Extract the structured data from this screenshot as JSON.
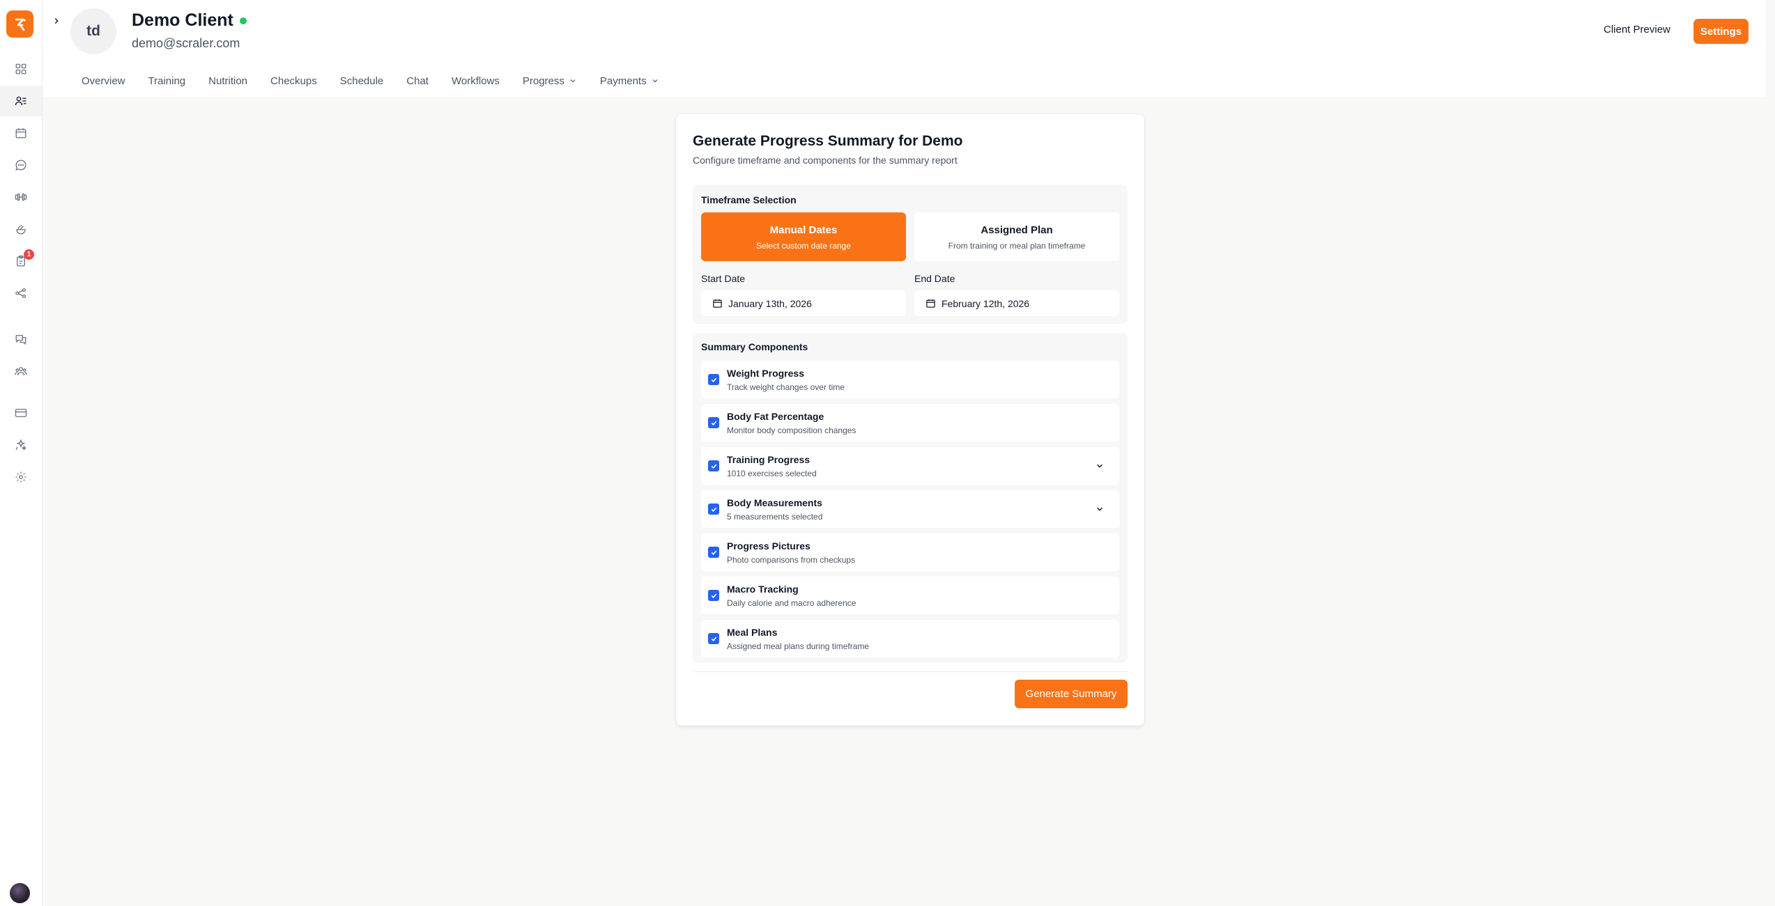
{
  "sidebar": {
    "badge_count": "1",
    "icons": [
      "dashboard-icon",
      "clients-icon",
      "calendar-icon",
      "messages-icon",
      "workouts-icon",
      "nutrition-icon",
      "checkups-icon",
      "workflows-icon",
      "chat-icon",
      "community-icon",
      "payments-icon",
      "ai-icon",
      "settings-icon"
    ],
    "active_item": "clients-icon"
  },
  "header": {
    "avatar_initials": "td",
    "client_name": "Demo Client",
    "client_email": "demo@scraler.com",
    "client_preview_label": "Client Preview",
    "settings_label": "Settings",
    "status": "online"
  },
  "tabs": [
    {
      "label": "Overview"
    },
    {
      "label": "Training"
    },
    {
      "label": "Nutrition"
    },
    {
      "label": "Checkups"
    },
    {
      "label": "Schedule"
    },
    {
      "label": "Chat"
    },
    {
      "label": "Workflows"
    },
    {
      "label": "Progress",
      "has_dropdown": true
    },
    {
      "label": "Payments",
      "has_dropdown": true
    }
  ],
  "summary": {
    "title": "Generate Progress Summary for Demo",
    "subtitle": "Configure timeframe and components for the summary report",
    "timeframe": {
      "section_title": "Timeframe Selection",
      "manual": {
        "title": "Manual Dates",
        "desc": "Select custom date range",
        "selected": true
      },
      "assigned": {
        "title": "Assigned Plan",
        "desc": "From training or meal plan timeframe",
        "selected": false
      },
      "start_label": "Start Date",
      "start_value": "January 13th, 2026",
      "end_label": "End Date",
      "end_value": "February 12th, 2026"
    },
    "components": {
      "section_title": "Summary Components",
      "items": [
        {
          "title": "Weight Progress",
          "desc": "Track weight changes over time",
          "checked": true,
          "expandable": false
        },
        {
          "title": "Body Fat Percentage",
          "desc": "Monitor body composition changes",
          "checked": true,
          "expandable": false
        },
        {
          "title": "Training Progress",
          "desc": "1010 exercises selected",
          "checked": true,
          "expandable": true
        },
        {
          "title": "Body Measurements",
          "desc": "5 measurements selected",
          "checked": true,
          "expandable": true
        },
        {
          "title": "Progress Pictures",
          "desc": "Photo comparisons from checkups",
          "checked": true,
          "expandable": false
        },
        {
          "title": "Macro Tracking",
          "desc": "Daily calorie and macro adherence",
          "checked": true,
          "expandable": false
        },
        {
          "title": "Meal Plans",
          "desc": "Assigned meal plans during timeframe",
          "checked": true,
          "expandable": false
        }
      ]
    },
    "generate_label": "Generate Summary"
  },
  "colors": {
    "accent": "#f97316",
    "checkbox": "#2563eb",
    "online": "#22c55e",
    "badge": "#ef4444"
  }
}
